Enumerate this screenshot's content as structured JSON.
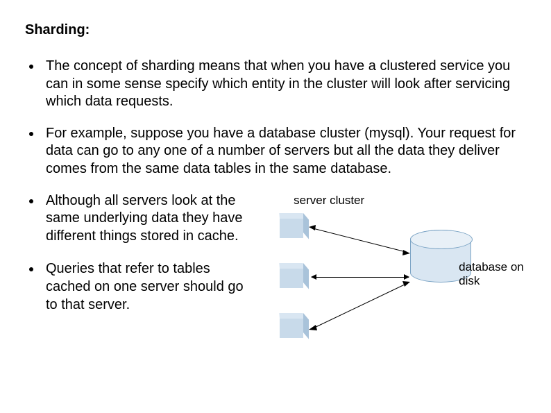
{
  "title": "Sharding:",
  "bullets": {
    "b1": "The concept of sharding means that when you have a clustered service you can in some sense specify which entity in the cluster will look after servicing which data requests.",
    "b2": "For example, suppose you have a database cluster (mysql). Your request for data can go to any one of a number of servers but all the data they deliver comes from the same data tables in the same database.",
    "b3": "Although all servers look at the same underlying data they have different things stored in cache.",
    "b4": "Queries that refer to tables cached on one server should go to that server."
  },
  "diagram": {
    "cluster_label": "server cluster",
    "db_label": "database on disk"
  }
}
